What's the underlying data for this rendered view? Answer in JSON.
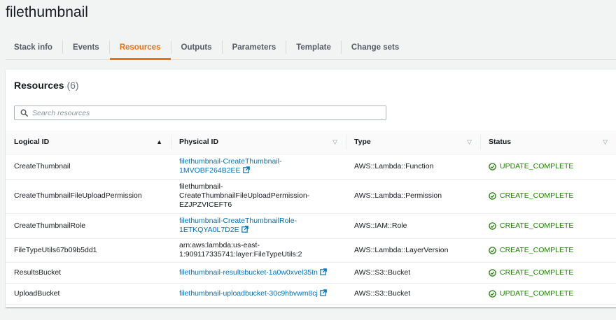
{
  "page": {
    "title": "filethumbnail"
  },
  "tabs": [
    {
      "label": "Stack info",
      "active": false
    },
    {
      "label": "Events",
      "active": false
    },
    {
      "label": "Resources",
      "active": true
    },
    {
      "label": "Outputs",
      "active": false
    },
    {
      "label": "Parameters",
      "active": false
    },
    {
      "label": "Template",
      "active": false
    },
    {
      "label": "Change sets",
      "active": false
    }
  ],
  "resources": {
    "title": "Resources",
    "count": "(6)",
    "search_placeholder": "Search resources",
    "columns": [
      "Logical ID",
      "Physical ID",
      "Type",
      "Status"
    ],
    "rows": [
      {
        "logical_id": "CreateThumbnail",
        "physical_id": "filethumbnail-CreateThumbnail-1MVOBF264B2EE",
        "physical_lines": [
          "filethumbnail-CreateThumbnail-",
          "1MVOBF264B2EE"
        ],
        "physical_link": true,
        "type": "AWS::Lambda::Function",
        "status": "UPDATE_COMPLETE"
      },
      {
        "logical_id": "CreateThumbnailFileUploadPermission",
        "physical_id": "filethumbnail-CreateThumbnailFileUploadPermission-EZJPZVICEFT6",
        "physical_lines": [
          "filethumbnail-",
          "CreateThumbnailFileUploadPermission-",
          "EZJPZVICEFT6"
        ],
        "physical_link": false,
        "type": "AWS::Lambda::Permission",
        "status": "CREATE_COMPLETE"
      },
      {
        "logical_id": "CreateThumbnailRole",
        "physical_id": "filethumbnail-CreateThumbnailRole-1ETKQYA0L7D2E",
        "physical_lines": [
          "filethumbnail-CreateThumbnailRole-",
          "1ETKQYA0L7D2E"
        ],
        "physical_link": true,
        "type": "AWS::IAM::Role",
        "status": "CREATE_COMPLETE"
      },
      {
        "logical_id": "FileTypeUtils67b09b5dd1",
        "physical_id": "arn:aws:lambda:us-east-1:909117335741:layer:FileTypeUtils:2",
        "physical_lines": [
          "arn:aws:lambda:us-east-",
          "1:909117335741:layer:FileTypeUtils:2"
        ],
        "physical_link": false,
        "type": "AWS::Lambda::LayerVersion",
        "status": "CREATE_COMPLETE"
      },
      {
        "logical_id": "ResultsBucket",
        "physical_id": "filethumbnail-resultsbucket-1a0w0xvel35tn",
        "physical_lines": [
          "filethumbnail-resultsbucket-1a0w0xvel35tn"
        ],
        "physical_link": true,
        "type": "AWS::S3::Bucket",
        "status": "CREATE_COMPLETE"
      },
      {
        "logical_id": "UploadBucket",
        "physical_id": "filethumbnail-uploadbucket-30c9hbvwm8cj",
        "physical_lines": [
          "filethumbnail-uploadbucket-30c9hbvwm8cj"
        ],
        "physical_link": true,
        "type": "AWS::S3::Bucket",
        "status": "UPDATE_COMPLETE"
      }
    ]
  },
  "colors": {
    "accent": "#ec7211",
    "link": "#0073bb",
    "success": "#1d8102"
  },
  "icons": {
    "search": "search-icon",
    "external_link": "external-link-icon",
    "status": "check-circle-icon",
    "sort_asc": "sort-ascending-icon",
    "sort_none": "sort-icon"
  }
}
